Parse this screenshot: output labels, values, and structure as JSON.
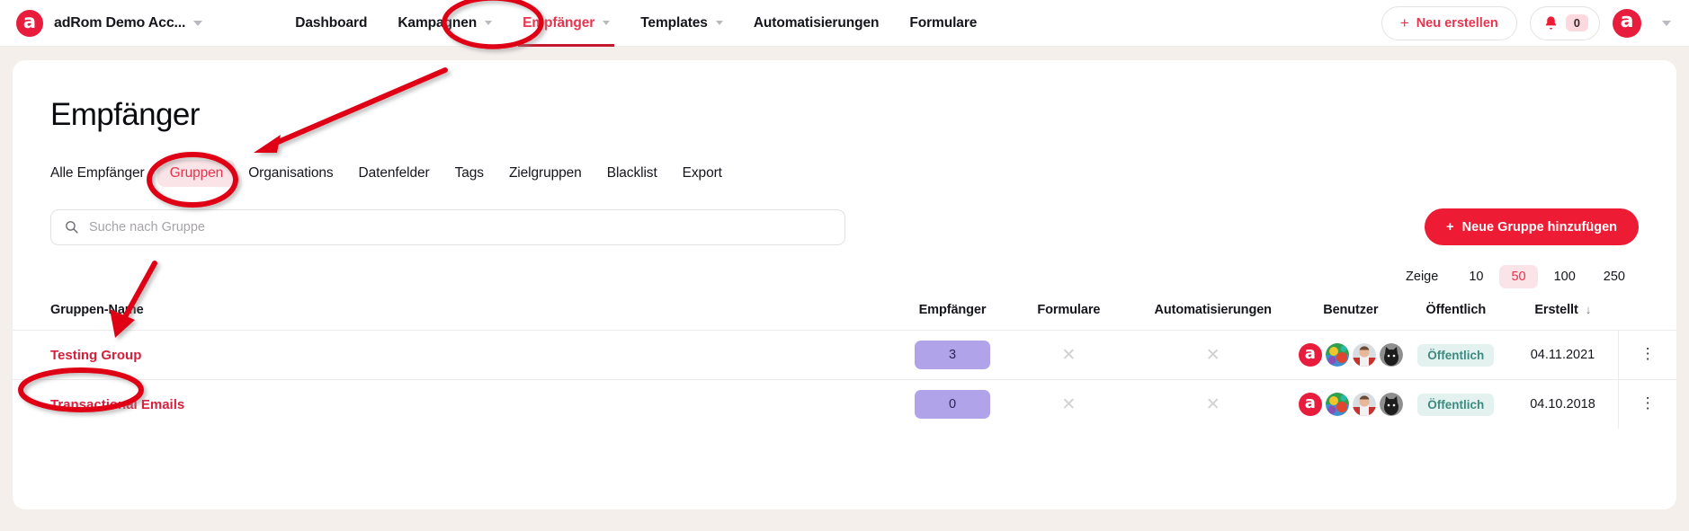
{
  "topnav": {
    "logo_letter": "a",
    "account_name": "adRom Demo Acc...",
    "menu": [
      {
        "label": "Dashboard",
        "has_caret": false,
        "active": false
      },
      {
        "label": "Kampagnen",
        "has_caret": true,
        "active": false
      },
      {
        "label": "Empfänger",
        "has_caret": true,
        "active": true
      },
      {
        "label": "Templates",
        "has_caret": true,
        "active": false
      },
      {
        "label": "Automatisierungen",
        "has_caret": false,
        "active": false
      },
      {
        "label": "Formulare",
        "has_caret": false,
        "active": false
      }
    ],
    "new_button_label": "Neu erstellen",
    "new_button_plus": "+",
    "notification_count": "0",
    "avatar_letter": "a"
  },
  "page": {
    "title": "Empfänger"
  },
  "subtabs": [
    {
      "label": "Alle Empfänger",
      "active": false
    },
    {
      "label": "Gruppen",
      "active": true
    },
    {
      "label": "Organisations",
      "active": false
    },
    {
      "label": "Datenfelder",
      "active": false
    },
    {
      "label": "Tags",
      "active": false
    },
    {
      "label": "Zielgruppen",
      "active": false
    },
    {
      "label": "Blacklist",
      "active": false
    },
    {
      "label": "Export",
      "active": false
    }
  ],
  "search": {
    "placeholder": "Suche nach Gruppe",
    "value": ""
  },
  "add_button": {
    "plus": "+",
    "label": "Neue Gruppe hinzufügen"
  },
  "pager": {
    "label": "Zeige",
    "options": [
      "10",
      "50",
      "100",
      "250"
    ],
    "selected": "50"
  },
  "table": {
    "columns": [
      "Gruppen-Name",
      "Empfänger",
      "Formulare",
      "Automatisierungen",
      "Benutzer",
      "Öffentlich",
      "Erstellt"
    ],
    "sort_column": "Erstellt",
    "sort_arrow": "↓",
    "rows": [
      {
        "name": "Testing Group",
        "recipients": "3",
        "forms": "✕",
        "automations": "✕",
        "users": [
          "a-logo-avatar",
          "parrot-avatar",
          "person-avatar",
          "cat-avatar"
        ],
        "public": "Öffentlich",
        "created": "04.11.2021",
        "menu": "⋮"
      },
      {
        "name": "Transactional Emails",
        "recipients": "0",
        "forms": "✕",
        "automations": "✕",
        "users": [
          "a-logo-avatar",
          "parrot-avatar",
          "person-avatar",
          "cat-avatar"
        ],
        "public": "Öffentlich",
        "created": "04.10.2018",
        "menu": "⋮"
      }
    ]
  },
  "annotations": {
    "color": "#e00018",
    "items": [
      {
        "type": "ellipse",
        "target": "nav-empfaenger"
      },
      {
        "type": "ellipse",
        "target": "subtab-gruppen"
      },
      {
        "type": "ellipse",
        "target": "row-testing-group"
      },
      {
        "type": "arrow",
        "from": "nav-empfaenger",
        "to": "subtab-gruppen"
      },
      {
        "type": "arrow",
        "from": "search-box",
        "to": "gruppen-name-header"
      }
    ]
  },
  "colors": {
    "brand_red": "#ed1b34",
    "link_red": "#d6203c",
    "accent_pink_bg": "#fbe4e7",
    "count_purple": "#b1a3ea",
    "public_teal": "#3d8b80",
    "public_bg": "#e4f2ef",
    "page_bg": "#f5efec",
    "annotation_red": "#e00018"
  }
}
